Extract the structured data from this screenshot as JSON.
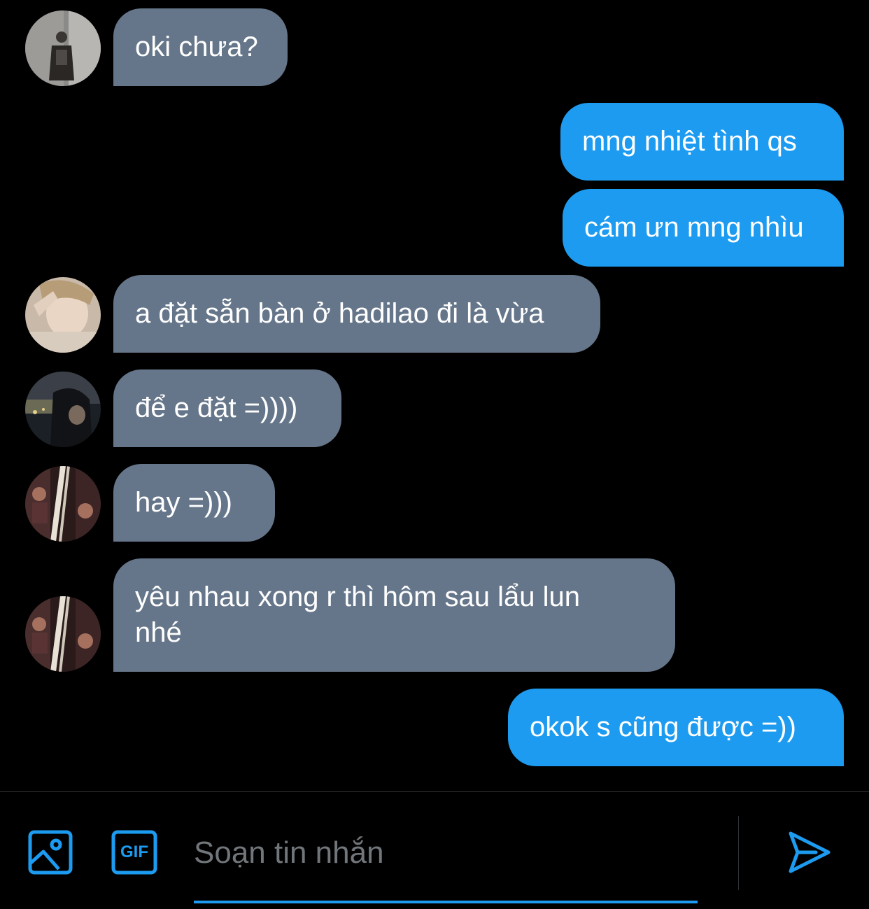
{
  "messages": [
    {
      "text": "oki chưa?",
      "direction": "incoming"
    },
    {
      "text": "mng nhiệt tình qs",
      "direction": "outgoing"
    },
    {
      "text": "cám ưn mng nhìu",
      "direction": "outgoing"
    },
    {
      "text": "a đặt sẵn bàn ở hadilao đi là vừa",
      "direction": "incoming"
    },
    {
      "text": "để e đặt =))))",
      "direction": "incoming"
    },
    {
      "text": "hay =)))",
      "direction": "incoming"
    },
    {
      "text": "yêu nhau xong r thì hôm sau lẩu lun",
      "text_line2": "nhé",
      "direction": "incoming"
    },
    {
      "text": "okok s cũng được =))",
      "direction": "outgoing"
    }
  ],
  "composer": {
    "placeholder": "Soạn tin nhắn",
    "gif_label": "GIF",
    "icons": [
      "image-icon",
      "gif-icon",
      "send-icon"
    ]
  },
  "colors": {
    "background": "#000000",
    "incoming_bubble": "#66768a",
    "outgoing_bubble": "#1d9bf0",
    "accent": "#1d9bf0",
    "placeholder": "#71767b"
  }
}
